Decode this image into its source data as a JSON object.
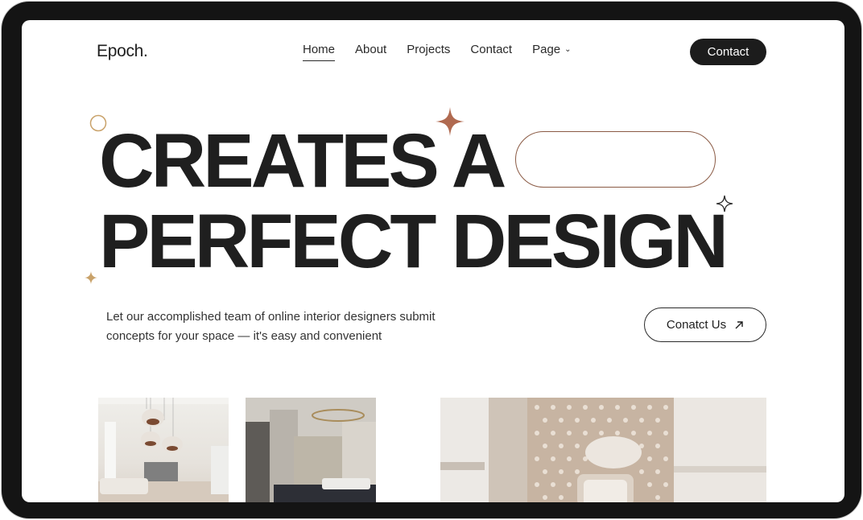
{
  "brand": {
    "logo": "Epoch."
  },
  "nav": {
    "items": [
      {
        "label": "Home",
        "active": true
      },
      {
        "label": "About",
        "active": false
      },
      {
        "label": "Projects",
        "active": false
      },
      {
        "label": "Contact",
        "active": false
      },
      {
        "label": "Page",
        "active": false,
        "has_dropdown": true
      }
    ],
    "cta_label": "Contact"
  },
  "hero": {
    "line1": "CREATES A",
    "line2": "PERFECT DESIGN",
    "description": "Let our accomplished team of online interior designers submit concepts for your space — it's easy and convenient",
    "button_label": "Conatct Us",
    "button_icon": "arrow-up-right-icon"
  },
  "colors": {
    "text": "#1f1f1f",
    "accent_brown": "#b06a50",
    "accent_gold": "#c9a26a",
    "button_dark": "#1c1c1c"
  },
  "gallery": [
    {
      "name": "living-room-photo"
    },
    {
      "name": "bedroom-photo"
    },
    {
      "name": "atrium-photo"
    }
  ]
}
